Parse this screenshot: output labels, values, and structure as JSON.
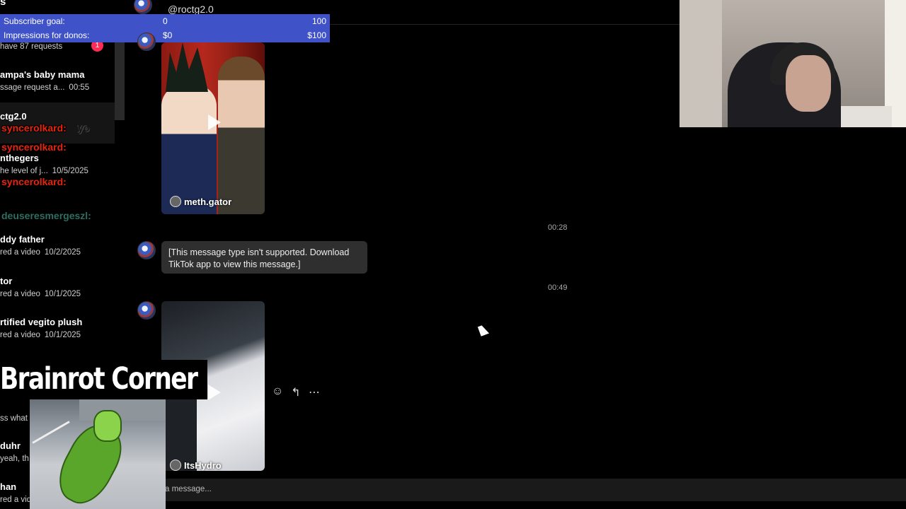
{
  "sidebar": {
    "top_letter": "s",
    "requests_text": "have 87 requests",
    "requests_badge": "1",
    "conversations": [
      {
        "name": "ampa's baby mama",
        "preview": "ssage request a...",
        "time": "00:55"
      },
      {
        "name": "ctg2.0",
        "preview": "",
        "time": ""
      },
      {
        "name": "nthegers",
        "preview": "he level of j...",
        "time": "10/5/2025"
      },
      {
        "name": "",
        "preview": "",
        "time": ""
      },
      {
        "name": "ddy father",
        "preview": "red a video",
        "time": "10/2/2025"
      },
      {
        "name": "tor",
        "preview": "red a video",
        "time": "10/1/2025"
      },
      {
        "name": "rtified vegito plush",
        "preview": "red a video",
        "time": "10/1/2025"
      },
      {
        "name": "",
        "preview": "ss what",
        "time": ""
      },
      {
        "name": "duhr",
        "preview": "yeah, th",
        "time": ""
      },
      {
        "name": "han",
        "preview": "red a vid",
        "time": ""
      }
    ]
  },
  "stream_chat": [
    {
      "user": "syncerolkard:",
      "message": "yo"
    },
    {
      "user": "syncerolkard:",
      "message": ""
    },
    {
      "user": "syncerolkard:",
      "message": ""
    },
    {
      "user": "deuseresmergeszl:",
      "message": ""
    }
  ],
  "subscriber_widget": {
    "rows": [
      {
        "label": "Subscriber goal:",
        "start": "0",
        "end": "100"
      },
      {
        "label": "Impressions for donos:",
        "start": "$0",
        "end": "$100"
      }
    ]
  },
  "header": {
    "handle": "@roctg2.0"
  },
  "messages": [
    {
      "type": "video",
      "author": "meth.gator"
    },
    {
      "type": "timestamp",
      "text": "00:28"
    },
    {
      "type": "text",
      "text": "[This message type isn't supported. Download TikTok app to view this message.]"
    },
    {
      "type": "timestamp",
      "text": "00:49"
    },
    {
      "type": "video",
      "author": "ItsHydro"
    }
  ],
  "message_actions": {
    "react": "emoji-icon",
    "reply": "reply-icon",
    "more": "more-icon"
  },
  "composer": {
    "placeholder": "a message..."
  },
  "overlay": {
    "brainrot_title": "Brainrot Corner"
  },
  "colors": {
    "subscriber_widget_bg": "#3f52c8",
    "chat_username": "#e8240c",
    "badge": "#fe2c55"
  }
}
